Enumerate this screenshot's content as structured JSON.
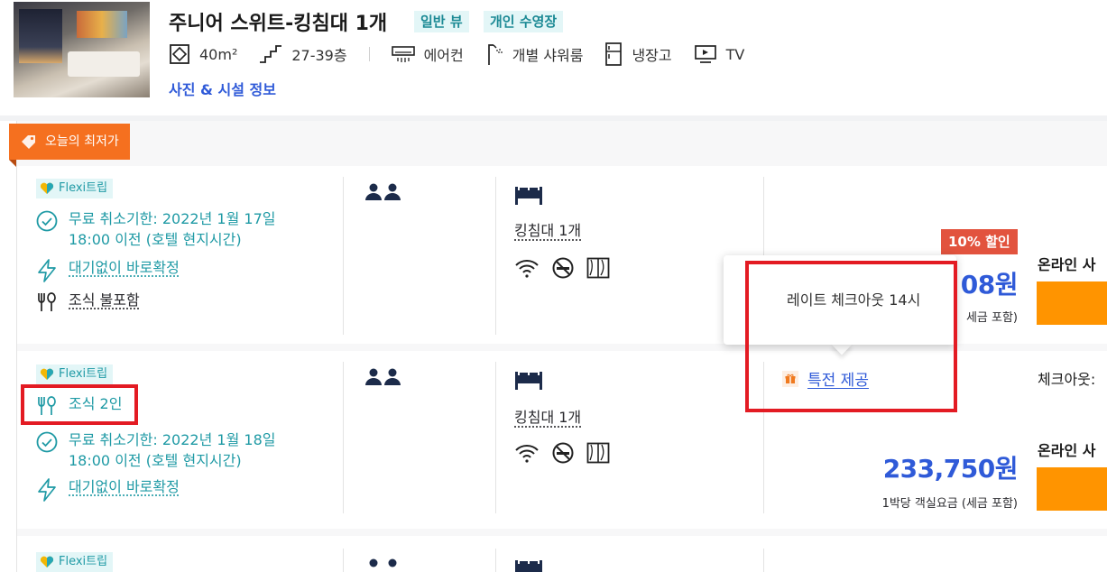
{
  "room": {
    "title": "주니어 스위트-킹침대 1개",
    "tags": [
      "일반 뷰",
      "개인 수영장"
    ],
    "amenities": {
      "size": "40m²",
      "floors": "27-39층",
      "aircon": "에어컨",
      "shower": "개별 샤워룸",
      "fridge": "냉장고",
      "tv": "TV"
    },
    "photo_link": "사진 & 시설 정보"
  },
  "best_badge": "오늘의 최저가",
  "rows": [
    {
      "flexi": "Flexi트립",
      "cancel": "무료 취소기한: 2022년 1월 17일 18:00 이전 (호텔 현지시간)",
      "cancel_line1": "무료 취소기한: 2022년 1월 17일",
      "cancel_line2": "18:00 이전 (호텔 현지시간)",
      "instant": "대기없이 바로확정",
      "meal": "조식 불포함",
      "bed": "킹침대 1개",
      "discount": "10% 할인",
      "price": "08원",
      "price_note": "세금 포함)",
      "online_label": "온라인 사"
    },
    {
      "flexi": "Flexi트립",
      "meal": "조식 2인",
      "cancel_line1": "무료 취소기한: 2022년 1월 18일",
      "cancel_line2": "18:00 이전 (호텔 현지시간)",
      "instant": "대기없이 바로확정",
      "bed": "킹침대 1개",
      "perk": "특전 제공",
      "checkout_label": "체크아웃:",
      "price": "233,750원",
      "price_note": "1박당 객실요금 (세금 포함)",
      "online_label": "온라인 사"
    },
    {
      "flexi": "Flexi트립"
    }
  ],
  "tooltip": {
    "text": "레이트 체크아웃 14시"
  },
  "colors": {
    "accent_blue": "#2f5ad8",
    "teal": "#1f9aa5",
    "badge_orange": "#f5701f",
    "discount_red": "#e2533e",
    "book_orange": "#ff9400",
    "highlight_red": "#e31b23"
  }
}
